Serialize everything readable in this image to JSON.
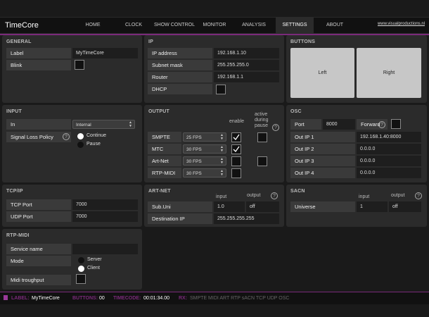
{
  "app": {
    "title": "TimeCore",
    "site": "www.visualproductions.nl"
  },
  "nav": [
    "HOME",
    "CLOCK",
    "SHOW CONTROL",
    "MONITOR",
    "ANALYSIS",
    "SETTINGS",
    "ABOUT"
  ],
  "general": {
    "title": "GENERAL",
    "label_lbl": "Label",
    "label_val": "MyTimeCore",
    "blink_lbl": "Blink"
  },
  "ip": {
    "title": "IP",
    "addr_lbl": "IP address",
    "addr_val": "192.168.1.10",
    "mask_lbl": "Subnet mask",
    "mask_val": "255.255.255.0",
    "router_lbl": "Router",
    "router_val": "192.168.1.1",
    "dhcp_lbl": "DHCP"
  },
  "buttons": {
    "title": "BUTTONS",
    "left": "Left",
    "right": "Right"
  },
  "input": {
    "title": "INPUT",
    "in_lbl": "In",
    "in_val": "Internal",
    "slp_lbl": "Signal Loss Policy",
    "opt1": "Continue",
    "opt2": "Pause"
  },
  "output": {
    "title": "OUTPUT",
    "enable": "enable",
    "active": "active during pause",
    "rows": [
      {
        "name": "SMPTE",
        "fps": "25 FPS"
      },
      {
        "name": "MTC",
        "fps": "30 FPS"
      },
      {
        "name": "Art-Net",
        "fps": "30 FPS"
      },
      {
        "name": "RTP-MIDI",
        "fps": "30 FPS"
      }
    ]
  },
  "osc": {
    "title": "OSC",
    "port_lbl": "Port",
    "port_val": "8000",
    "fwd_lbl": "Forward",
    "rows": [
      {
        "lbl": "Out IP 1",
        "val": "192.168.1.40:8000"
      },
      {
        "lbl": "Out IP 2",
        "val": "0.0.0.0"
      },
      {
        "lbl": "Out IP 3",
        "val": "0.0.0.0"
      },
      {
        "lbl": "Out IP 4",
        "val": "0.0.0.0"
      }
    ]
  },
  "tcpip": {
    "title": "TCP/IP",
    "tcp_lbl": "TCP Port",
    "tcp_val": "7000",
    "udp_lbl": "UDP Port",
    "udp_val": "7000"
  },
  "artnet": {
    "title": "ART-NET",
    "input": "input",
    "output": "output",
    "sub_lbl": "Sub.Uni",
    "sub_in": "1.0",
    "sub_out": "off",
    "dest_lbl": "Destination IP",
    "dest_val": "255.255.255.255"
  },
  "sacn": {
    "title": "SACN",
    "input": "input",
    "output": "output",
    "uni_lbl": "Universe",
    "uni_in": "1",
    "uni_out": "off"
  },
  "rtpmidi": {
    "title": "RTP-MIDI",
    "svc_lbl": "Service name",
    "mode_lbl": "Mode",
    "opt1": "Server",
    "opt2": "Client",
    "midi_lbl": "Midi troughput"
  },
  "status": {
    "label_k": "LABEL:",
    "label_v": "MyTimeCore",
    "buttons_k": "BUTTONS:",
    "buttons_v": "00",
    "tc_k": "TIMECODE:",
    "tc_v": "00:01:34.00",
    "rx_k": "RX:",
    "rx_list": "SMPTE  MIDI  ART  RTP  sACN  TCP  UDP  OSC"
  }
}
